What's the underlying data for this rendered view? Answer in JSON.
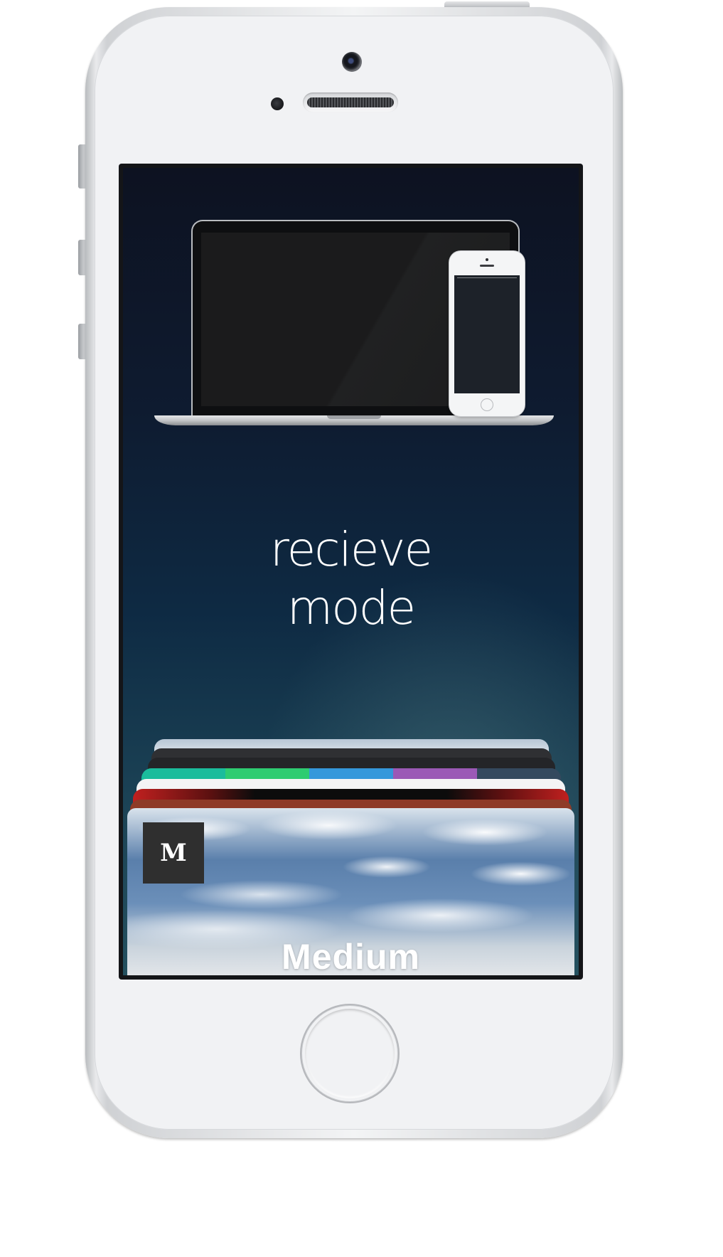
{
  "headline": {
    "line1": "recieve",
    "line2": "mode"
  },
  "illustration": {
    "devices": [
      "laptop",
      "phone"
    ]
  },
  "cards": {
    "stack": [
      {
        "name": "sky-card",
        "style": "sky"
      },
      {
        "name": "dark-card-1",
        "color": "#2f3033"
      },
      {
        "name": "dark-card-2",
        "color": "#242528"
      },
      {
        "name": "colors-card",
        "stripes": [
          "#1abc9c",
          "#2ecc71",
          "#3498db",
          "#9b59b6",
          "#34495e"
        ]
      },
      {
        "name": "white-card",
        "color": "#f4f4f5"
      },
      {
        "name": "gold-card",
        "style": "gold-on-black"
      },
      {
        "name": "red-card",
        "color": "#8e3b28"
      }
    ],
    "front": {
      "logo_letter": "M",
      "title": "Medium"
    }
  },
  "colors": {
    "screen_top": "#0d1221",
    "screen_bottom": "#24505f",
    "phone_face": "#f1f2f4"
  },
  "icons": {
    "camera": "front-camera-icon",
    "home": "home-button-icon"
  }
}
